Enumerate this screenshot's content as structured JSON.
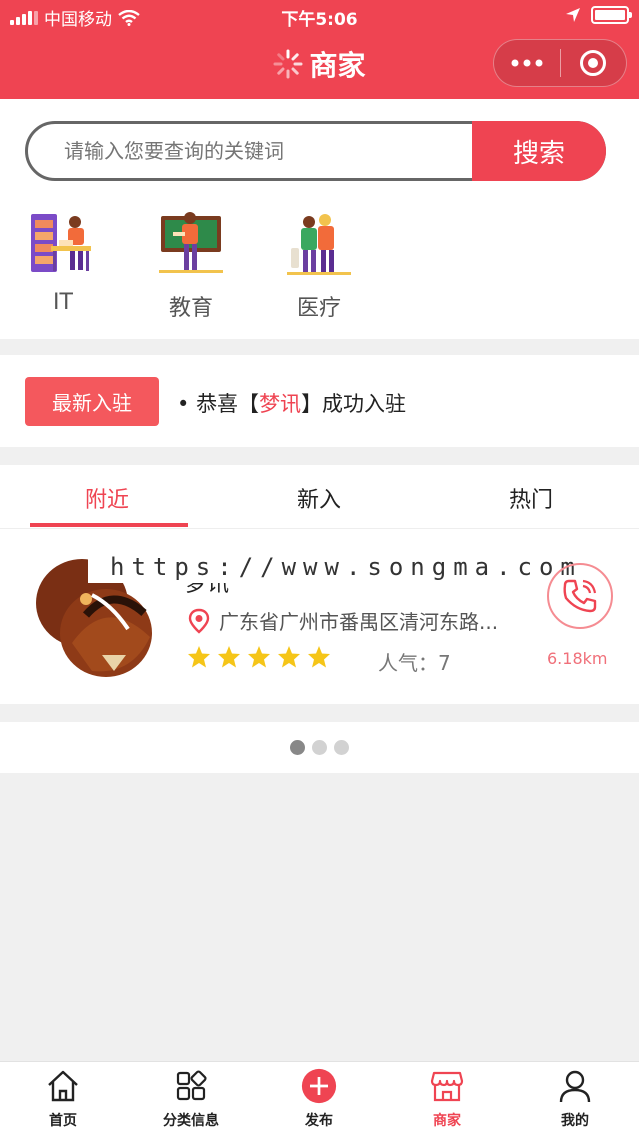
{
  "status_bar": {
    "carrier": "中国移动",
    "time": "下午5:06"
  },
  "nav": {
    "title": "商家"
  },
  "search": {
    "placeholder": "请输入您要查询的关键词",
    "button_label": "搜索"
  },
  "categories": [
    {
      "label": "IT",
      "icon": "it-worker-icon"
    },
    {
      "label": "教育",
      "icon": "teacher-icon"
    },
    {
      "label": "医疗",
      "icon": "medical-icon"
    }
  ],
  "news": {
    "badge": "最新入驻",
    "prefix": "恭喜【",
    "highlight": "梦讯",
    "suffix": "】成功入驻"
  },
  "tabs": [
    {
      "label": "附近",
      "active": true
    },
    {
      "label": "新入",
      "active": false
    },
    {
      "label": "热门",
      "active": false
    }
  ],
  "listing": {
    "name": "梦讯",
    "address": "广东省广州市番禺区清河东路...",
    "rating": 5,
    "popularity_label": "人气：",
    "popularity_value": "7",
    "distance": "6.18km"
  },
  "watermark": "https://www.songma.com",
  "pager": {
    "count": 3,
    "active": 0
  },
  "tabbar": [
    {
      "label": "首页",
      "icon": "home-icon"
    },
    {
      "label": "分类信息",
      "icon": "grid-icon"
    },
    {
      "label": "发布",
      "icon": "plus-icon"
    },
    {
      "label": "商家",
      "icon": "shop-icon",
      "active": true
    },
    {
      "label": "我的",
      "icon": "user-icon"
    }
  ],
  "colors": {
    "brand": "#ef4452",
    "star": "#f5c518"
  }
}
